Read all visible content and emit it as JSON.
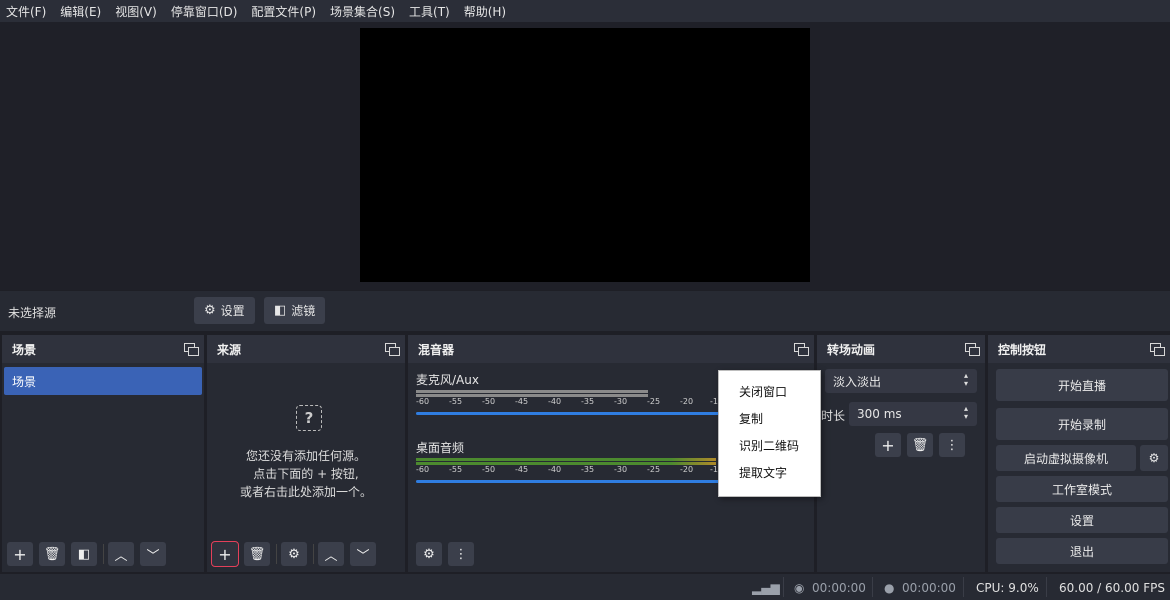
{
  "menu": [
    "文件(F)",
    "编辑(E)",
    "视图(V)",
    "停靠窗口(D)",
    "配置文件(P)",
    "场景集合(S)",
    "工具(T)",
    "帮助(H)"
  ],
  "source_toolbar": {
    "no_source": "未选择源",
    "settings_label": "设置",
    "filters_label": "滤镜"
  },
  "scenes": {
    "title": "场景",
    "items": [
      "场景"
    ]
  },
  "sources": {
    "title": "来源",
    "empty_line1": "您还没有添加任何源。",
    "empty_line2": "点击下面的 + 按钮,",
    "empty_line3": "或者右击此处添加一个。"
  },
  "mixer": {
    "title": "混音器",
    "tracks": [
      {
        "name": "麦克风/Aux"
      },
      {
        "name": "桌面音频"
      }
    ],
    "ticks": [
      "-60",
      "-55",
      "-50",
      "-45",
      "-40",
      "-35",
      "-30",
      "-25",
      "-20",
      "-15"
    ]
  },
  "transitions": {
    "title": "转场动画",
    "selected": "淡入淡出",
    "duration_label": "时长",
    "duration_value": "300 ms"
  },
  "controls": {
    "title": "控制按钮",
    "start_stream": "开始直播",
    "start_record": "开始录制",
    "virtual_cam": "启动虚拟摄像机",
    "studio_mode": "工作室模式",
    "settings": "设置",
    "exit": "退出"
  },
  "context_menu": [
    "关闭窗口",
    "复制",
    "识别二维码",
    "提取文字"
  ],
  "status": {
    "stream_time": "00:00:00",
    "record_time": "00:00:00",
    "cpu": "CPU: 9.0%",
    "fps": "60.00 / 60.00 FPS"
  },
  "colors": {
    "accent_blue": "#3a63b6",
    "volume_blue": "#2f7de1",
    "meter_green": "#4c8a2f",
    "meter_yellow": "#b08a2a",
    "active_outline": "#e3405a"
  }
}
